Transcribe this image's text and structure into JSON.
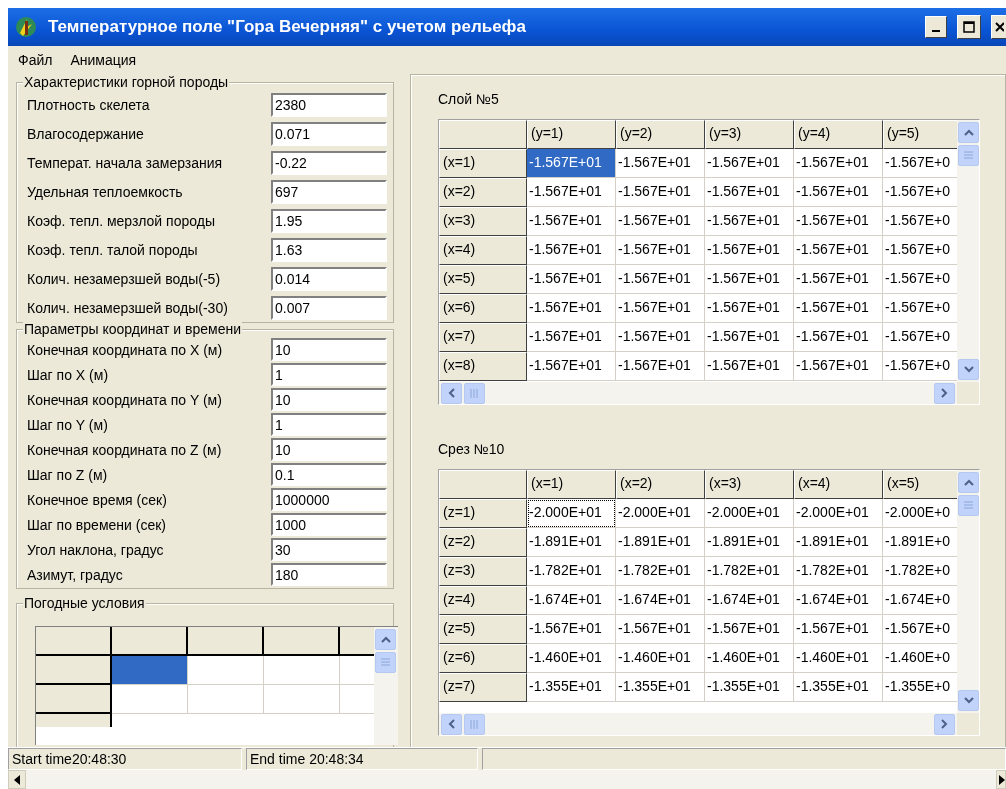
{
  "window": {
    "title": "Температурное поле \"Гора Вечерняя\" с учетом рельефа"
  },
  "menu": [
    "Файл",
    "Анимация"
  ],
  "rock_group": {
    "title": "Характеристики горной породы",
    "fields": [
      {
        "label": "Плотность скелета",
        "value": "2380"
      },
      {
        "label": "Влагосодержание",
        "value": "0.071"
      },
      {
        "label": "Температ. начала замерзания",
        "value": "-0.22"
      },
      {
        "label": "Удельная теплоемкость",
        "value": "697"
      },
      {
        "label": "Коэф. тепл. мерзлой породы",
        "value": "1.95"
      },
      {
        "label": "Коэф. тепл. талой породы",
        "value": "1.63"
      },
      {
        "label": "Колич. незамерзшей воды(-5)",
        "value": "0.014"
      },
      {
        "label": "Колич.  незамерзшей воды(-30)",
        "value": "0.007"
      }
    ]
  },
  "coords_group": {
    "title": "Параметры координат и времени",
    "fields": [
      {
        "label": "Конечная координата по X (м)",
        "value": "10"
      },
      {
        "label": "Шаг по X (м)",
        "value": "1"
      },
      {
        "label": "Конечная координата по Y (м)",
        "value": "10"
      },
      {
        "label": "Шаг по Y (м)",
        "value": "1"
      },
      {
        "label": "Конечная координата по  Z (м)",
        "value": "10"
      },
      {
        "label": "Шаг по Z (м)",
        "value": "0.1"
      },
      {
        "label": "Конечное время (сек)",
        "value": "1000000"
      },
      {
        "label": "Шаг по времени (сек)",
        "value": "1000"
      },
      {
        "label": "Угол наклона, градус",
        "value": "30"
      },
      {
        "label": "Азимут, градус",
        "value": "180"
      }
    ]
  },
  "weather_group": {
    "title": "Погодные условия",
    "rows": [
      {
        "selected": [
          true,
          false,
          false,
          false
        ]
      },
      {
        "selected": [
          false,
          false,
          false,
          false
        ]
      }
    ]
  },
  "layer_grid": {
    "title": "Слой №5",
    "columns": [
      "(y=1)",
      "(y=2)",
      "(y=3)",
      "(y=4)",
      "(y=5)"
    ],
    "rows": [
      {
        "label": "(x=1)",
        "cells": [
          "-1.567E+01",
          "-1.567E+01",
          "-1.567E+01",
          "-1.567E+01",
          "-1.567E+0"
        ],
        "selected": [
          true,
          false,
          false,
          false,
          false
        ],
        "focused": [
          false,
          false,
          false,
          false,
          false
        ]
      },
      {
        "label": "(x=2)",
        "cells": [
          "-1.567E+01",
          "-1.567E+01",
          "-1.567E+01",
          "-1.567E+01",
          "-1.567E+0"
        ],
        "selected": [
          false,
          false,
          false,
          false,
          false
        ],
        "focused": [
          false,
          false,
          false,
          false,
          false
        ]
      },
      {
        "label": "(x=3)",
        "cells": [
          "-1.567E+01",
          "-1.567E+01",
          "-1.567E+01",
          "-1.567E+01",
          "-1.567E+0"
        ],
        "selected": [
          false,
          false,
          false,
          false,
          false
        ],
        "focused": [
          false,
          false,
          false,
          false,
          false
        ]
      },
      {
        "label": "(x=4)",
        "cells": [
          "-1.567E+01",
          "-1.567E+01",
          "-1.567E+01",
          "-1.567E+01",
          "-1.567E+0"
        ],
        "selected": [
          false,
          false,
          false,
          false,
          false
        ],
        "focused": [
          false,
          false,
          false,
          false,
          false
        ]
      },
      {
        "label": "(x=5)",
        "cells": [
          "-1.567E+01",
          "-1.567E+01",
          "-1.567E+01",
          "-1.567E+01",
          "-1.567E+0"
        ],
        "selected": [
          false,
          false,
          false,
          false,
          false
        ],
        "focused": [
          false,
          false,
          false,
          false,
          false
        ]
      },
      {
        "label": "(x=6)",
        "cells": [
          "-1.567E+01",
          "-1.567E+01",
          "-1.567E+01",
          "-1.567E+01",
          "-1.567E+0"
        ],
        "selected": [
          false,
          false,
          false,
          false,
          false
        ],
        "focused": [
          false,
          false,
          false,
          false,
          false
        ]
      },
      {
        "label": "(x=7)",
        "cells": [
          "-1.567E+01",
          "-1.567E+01",
          "-1.567E+01",
          "-1.567E+01",
          "-1.567E+0"
        ],
        "selected": [
          false,
          false,
          false,
          false,
          false
        ],
        "focused": [
          false,
          false,
          false,
          false,
          false
        ]
      },
      {
        "label": "(x=8)",
        "cells": [
          "-1.567E+01",
          "-1.567E+01",
          "-1.567E+01",
          "-1.567E+01",
          "-1.567E+0"
        ],
        "selected": [
          false,
          false,
          false,
          false,
          false
        ],
        "focused": [
          false,
          false,
          false,
          false,
          false
        ]
      }
    ]
  },
  "slice_grid": {
    "title": "Срез №10",
    "columns": [
      "(x=1)",
      "(x=2)",
      "(x=3)",
      "(x=4)",
      "(x=5)"
    ],
    "rows": [
      {
        "label": "(z=1)",
        "cells": [
          "-2.000E+01",
          "-2.000E+01",
          "-2.000E+01",
          "-2.000E+01",
          "-2.000E+0"
        ],
        "selected": [
          false,
          false,
          false,
          false,
          false
        ],
        "focused": [
          true,
          false,
          false,
          false,
          false
        ]
      },
      {
        "label": "(z=2)",
        "cells": [
          "-1.891E+01",
          "-1.891E+01",
          "-1.891E+01",
          "-1.891E+01",
          "-1.891E+0"
        ],
        "selected": [
          false,
          false,
          false,
          false,
          false
        ],
        "focused": [
          false,
          false,
          false,
          false,
          false
        ]
      },
      {
        "label": "(z=3)",
        "cells": [
          "-1.782E+01",
          "-1.782E+01",
          "-1.782E+01",
          "-1.782E+01",
          "-1.782E+0"
        ],
        "selected": [
          false,
          false,
          false,
          false,
          false
        ],
        "focused": [
          false,
          false,
          false,
          false,
          false
        ]
      },
      {
        "label": "(z=4)",
        "cells": [
          "-1.674E+01",
          "-1.674E+01",
          "-1.674E+01",
          "-1.674E+01",
          "-1.674E+0"
        ],
        "selected": [
          false,
          false,
          false,
          false,
          false
        ],
        "focused": [
          false,
          false,
          false,
          false,
          false
        ]
      },
      {
        "label": "(z=5)",
        "cells": [
          "-1.567E+01",
          "-1.567E+01",
          "-1.567E+01",
          "-1.567E+01",
          "-1.567E+0"
        ],
        "selected": [
          false,
          false,
          false,
          false,
          false
        ],
        "focused": [
          false,
          false,
          false,
          false,
          false
        ]
      },
      {
        "label": "(z=6)",
        "cells": [
          "-1.460E+01",
          "-1.460E+01",
          "-1.460E+01",
          "-1.460E+01",
          "-1.460E+0"
        ],
        "selected": [
          false,
          false,
          false,
          false,
          false
        ],
        "focused": [
          false,
          false,
          false,
          false,
          false
        ]
      },
      {
        "label": "(z=7)",
        "cells": [
          "-1.355E+01",
          "-1.355E+01",
          "-1.355E+01",
          "-1.355E+01",
          "-1.355E+0"
        ],
        "selected": [
          false,
          false,
          false,
          false,
          false
        ],
        "focused": [
          false,
          false,
          false,
          false,
          false
        ]
      }
    ]
  },
  "status_bar": [
    "Start time20:48:30",
    "End time 20:48:34"
  ]
}
